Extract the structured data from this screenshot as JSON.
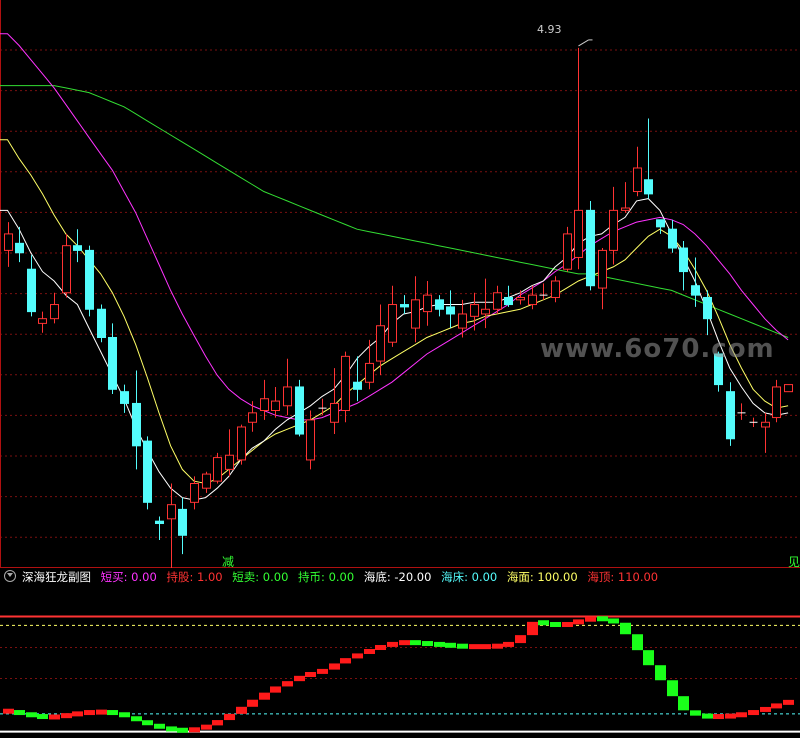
{
  "colors": {
    "up": "#ff3333",
    "down": "#54fcfc",
    "grid": "#7a1010",
    "ma_white": "#ffffff",
    "ma_yellow": "#ffff66",
    "ma_magenta": "#ff33ff",
    "ma_green": "#33dd33"
  },
  "header": {
    "indicator_name": "深海狂龙副图",
    "items": [
      {
        "label": "短买: 0.00",
        "color": "#ff33ff"
      },
      {
        "label": "持股: 1.00",
        "color": "#ff3333"
      },
      {
        "label": "短卖: 0.00",
        "color": "#33ff33"
      },
      {
        "label": "持币: 0.00",
        "color": "#33ff33"
      },
      {
        "label": "海底: -20.00",
        "color": "#ffffff"
      },
      {
        "label": "海床: 0.00",
        "color": "#54fcfc"
      },
      {
        "label": "海面: 100.00",
        "color": "#ffff66"
      },
      {
        "label": "海顶: 110.00",
        "color": "#ff3333"
      }
    ]
  },
  "signals": [
    {
      "text": "减"
    },
    {
      "text": "见"
    }
  ],
  "watermark": "www.6o70.com",
  "chart_data": [
    {
      "type": "candlestick",
      "price_range": [
        2.8,
        5.0
      ],
      "annotation": {
        "text": "4.93",
        "value": 4.93
      },
      "grid": true,
      "candles": [
        [
          4.03,
          4.1,
          4.15,
          3.96
        ],
        [
          4.06,
          4.02,
          4.13,
          3.98
        ],
        [
          3.95,
          3.77,
          4.01,
          3.75
        ],
        [
          3.72,
          3.74,
          3.77,
          3.68
        ],
        [
          3.74,
          3.8,
          3.85,
          3.72
        ],
        [
          3.85,
          4.05,
          4.1,
          3.83
        ],
        [
          4.05,
          4.03,
          4.12,
          3.98
        ],
        [
          4.03,
          3.78,
          4.05,
          3.75
        ],
        [
          3.78,
          3.66,
          3.8,
          3.64
        ],
        [
          3.66,
          3.44,
          3.72,
          3.42
        ],
        [
          3.43,
          3.38,
          3.46,
          3.34
        ],
        [
          3.38,
          3.2,
          3.52,
          3.1
        ],
        [
          3.22,
          2.96,
          3.24,
          2.93
        ],
        [
          2.88,
          2.87,
          2.9,
          2.8
        ],
        [
          2.89,
          2.95,
          3.04,
          2.68
        ],
        [
          2.93,
          2.82,
          2.98,
          2.74
        ],
        [
          2.96,
          3.04,
          3.07,
          2.93
        ],
        [
          3.02,
          3.08,
          3.09,
          3.0
        ],
        [
          3.05,
          3.15,
          3.17,
          3.04
        ],
        [
          3.1,
          3.16,
          3.27,
          3.07
        ],
        [
          3.14,
          3.28,
          3.29,
          3.12
        ],
        [
          3.3,
          3.34,
          3.39,
          3.26
        ],
        [
          3.35,
          3.4,
          3.48,
          3.31
        ],
        [
          3.35,
          3.39,
          3.45,
          3.32
        ],
        [
          3.37,
          3.45,
          3.57,
          3.33
        ],
        [
          3.45,
          3.25,
          3.48,
          3.24
        ],
        [
          3.14,
          3.31,
          3.35,
          3.1
        ],
        [
          3.36,
          3.36,
          3.4,
          3.33
        ],
        [
          3.3,
          3.38,
          3.53,
          3.25
        ],
        [
          3.35,
          3.58,
          3.6,
          3.3
        ],
        [
          3.47,
          3.44,
          3.58,
          3.39
        ],
        [
          3.47,
          3.55,
          3.65,
          3.44
        ],
        [
          3.56,
          3.71,
          3.8,
          3.5
        ],
        [
          3.64,
          3.8,
          3.88,
          3.62
        ],
        [
          3.8,
          3.79,
          3.84,
          3.76
        ],
        [
          3.7,
          3.82,
          3.92,
          3.64
        ],
        [
          3.77,
          3.84,
          3.9,
          3.71
        ],
        [
          3.82,
          3.78,
          3.84,
          3.75
        ],
        [
          3.79,
          3.76,
          3.86,
          3.7
        ],
        [
          3.7,
          3.76,
          3.82,
          3.66
        ],
        [
          3.75,
          3.8,
          3.85,
          3.69
        ],
        [
          3.76,
          3.78,
          3.91,
          3.7
        ],
        [
          3.78,
          3.85,
          3.88,
          3.76
        ],
        [
          3.83,
          3.8,
          3.88,
          3.79
        ],
        [
          3.82,
          3.83,
          3.86,
          3.8
        ],
        [
          3.8,
          3.84,
          3.88,
          3.78
        ],
        [
          3.84,
          3.84,
          3.89,
          3.82
        ],
        [
          3.83,
          3.9,
          3.92,
          3.81
        ],
        [
          3.95,
          4.1,
          4.13,
          3.94
        ],
        [
          4.0,
          4.2,
          4.89,
          3.95
        ],
        [
          4.2,
          3.88,
          4.24,
          3.86
        ],
        [
          3.87,
          4.03,
          4.04,
          3.78
        ],
        [
          4.03,
          4.2,
          4.3,
          3.97
        ],
        [
          4.2,
          4.21,
          4.32,
          4.19
        ],
        [
          4.28,
          4.38,
          4.47,
          4.26
        ],
        [
          4.33,
          4.27,
          4.59,
          4.25
        ],
        [
          4.16,
          4.13,
          4.14,
          4.1
        ],
        [
          4.12,
          4.04,
          4.16,
          4.02
        ],
        [
          4.04,
          3.94,
          4.07,
          3.86
        ],
        [
          3.88,
          3.84,
          4.0,
          3.79
        ],
        [
          3.83,
          3.74,
          3.86,
          3.67
        ],
        [
          3.59,
          3.46,
          3.6,
          3.43
        ],
        [
          3.43,
          3.23,
          3.47,
          3.2
        ],
        [
          3.34,
          3.34,
          3.38,
          3.31
        ],
        [
          3.3,
          3.3,
          3.32,
          3.28
        ],
        [
          3.28,
          3.3,
          3.34,
          3.17
        ],
        [
          3.32,
          3.45,
          3.48,
          3.3
        ],
        [
          3.43,
          3.46,
          3.46,
          3.43
        ]
      ],
      "ma_white": [
        4.2,
        4.12,
        4.02,
        3.94,
        3.9,
        3.84,
        3.8,
        3.7,
        3.6,
        3.5,
        3.4,
        3.28,
        3.18,
        3.09,
        3.02,
        2.98,
        2.97,
        2.98,
        3.02,
        3.07,
        3.14,
        3.19,
        3.22,
        3.27,
        3.31,
        3.34,
        3.37,
        3.41,
        3.44,
        3.5,
        3.57,
        3.62,
        3.66,
        3.72,
        3.76,
        3.77,
        3.79,
        3.8,
        3.8,
        3.8,
        3.81,
        3.81,
        3.81,
        3.83,
        3.85,
        3.88,
        3.9,
        3.96,
        4.0,
        4.06,
        4.09,
        4.1,
        4.14,
        4.17,
        4.24,
        4.25,
        4.2,
        4.1,
        4.0,
        3.9,
        3.78,
        3.65,
        3.53,
        3.45,
        3.38,
        3.34,
        3.33,
        3.34
      ],
      "ma_yellow": [
        4.5,
        4.42,
        4.35,
        4.27,
        4.18,
        4.1,
        4.05,
        3.99,
        3.93,
        3.85,
        3.75,
        3.63,
        3.49,
        3.34,
        3.2,
        3.1,
        3.05,
        3.04,
        3.06,
        3.1,
        3.14,
        3.18,
        3.22,
        3.25,
        3.27,
        3.29,
        3.31,
        3.34,
        3.37,
        3.42,
        3.46,
        3.5,
        3.54,
        3.57,
        3.6,
        3.63,
        3.66,
        3.68,
        3.7,
        3.72,
        3.73,
        3.75,
        3.76,
        3.77,
        3.78,
        3.8,
        3.82,
        3.84,
        3.87,
        3.9,
        3.92,
        3.94,
        3.96,
        3.99,
        4.04,
        4.09,
        4.12,
        4.09,
        4.03,
        3.95,
        3.86,
        3.75,
        3.63,
        3.53,
        3.44,
        3.39,
        3.36,
        3.37
      ],
      "ma_magenta": [
        4.95,
        4.9,
        4.84,
        4.78,
        4.72,
        4.65,
        4.58,
        4.51,
        4.44,
        4.37,
        4.28,
        4.19,
        4.08,
        3.97,
        3.86,
        3.76,
        3.67,
        3.58,
        3.5,
        3.44,
        3.4,
        3.37,
        3.35,
        3.33,
        3.32,
        3.31,
        3.31,
        3.32,
        3.34,
        3.36,
        3.38,
        3.41,
        3.44,
        3.47,
        3.51,
        3.55,
        3.59,
        3.62,
        3.65,
        3.68,
        3.71,
        3.74,
        3.77,
        3.8,
        3.84,
        3.87,
        3.9,
        3.94,
        3.97,
        4.01,
        4.05,
        4.08,
        4.11,
        4.13,
        4.15,
        4.16,
        4.17,
        4.16,
        4.14,
        4.1,
        4.05,
        3.99,
        3.93,
        3.86,
        3.8,
        3.74,
        3.69,
        3.65
      ],
      "ma_green": [
        4.73,
        4.73,
        4.73,
        4.73,
        4.73,
        4.72,
        4.71,
        4.7,
        4.68,
        4.66,
        4.64,
        4.61,
        4.58,
        4.55,
        4.52,
        4.49,
        4.46,
        4.43,
        4.4,
        4.37,
        4.34,
        4.31,
        4.28,
        4.26,
        4.24,
        4.22,
        4.2,
        4.18,
        4.16,
        4.14,
        4.12,
        4.11,
        4.1,
        4.09,
        4.08,
        4.07,
        4.06,
        4.05,
        4.04,
        4.03,
        4.02,
        4.01,
        4.0,
        3.99,
        3.98,
        3.97,
        3.96,
        3.95,
        3.94,
        3.93,
        3.93,
        3.92,
        3.91,
        3.9,
        3.89,
        3.88,
        3.87,
        3.86,
        3.84,
        3.82,
        3.8,
        3.78,
        3.76,
        3.74,
        3.72,
        3.7,
        3.68,
        3.66
      ]
    },
    {
      "type": "bar",
      "name": "深海狂龙副图",
      "value_range": [
        -25,
        140
      ],
      "reference_lines": [
        {
          "label": "海底",
          "value": -20,
          "color": "#ffffff"
        },
        {
          "label": "海床",
          "value": 0,
          "color": "#54fcfc"
        },
        {
          "label": "海面",
          "value": 100,
          "color": "#ffff66"
        },
        {
          "label": "海顶",
          "value": 110,
          "color": "#ff3333"
        }
      ],
      "values": [
        3,
        0,
        -2,
        -4,
        -3,
        -1,
        1,
        2,
        2,
        1,
        -3,
        -8,
        -12,
        -16,
        -18,
        -19,
        -17,
        -13,
        -7,
        0,
        8,
        16,
        24,
        31,
        37,
        43,
        46,
        50,
        57,
        63,
        68,
        73,
        77,
        80,
        81,
        80,
        79,
        78,
        77,
        76,
        76,
        76,
        77,
        80,
        89,
        104,
        102,
        100,
        102,
        106,
        108,
        107,
        103,
        90,
        72,
        55,
        38,
        20,
        4,
        -2,
        -3,
        -3,
        -2,
        0,
        3,
        7,
        11,
        15
      ]
    }
  ]
}
